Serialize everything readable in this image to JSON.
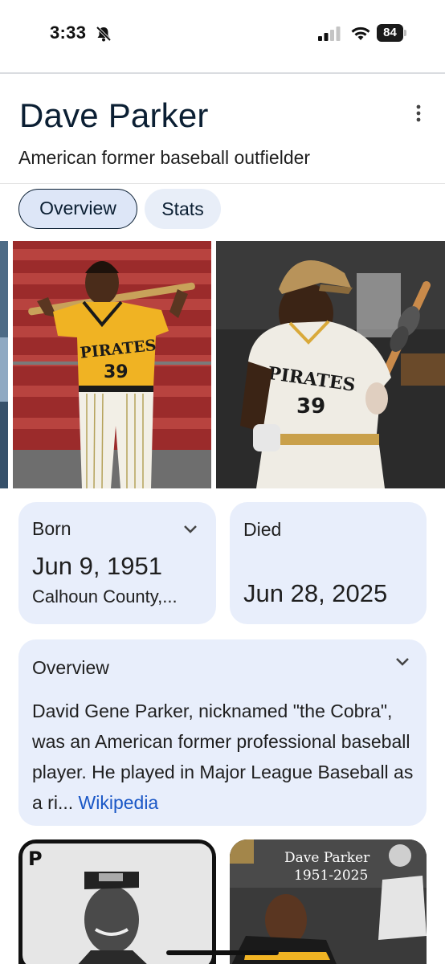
{
  "status_bar": {
    "time": "3:33",
    "battery": "84",
    "icons": [
      "bell-slash-icon",
      "signal-icon",
      "wifi-icon",
      "battery-icon"
    ]
  },
  "header": {
    "title": "Dave Parker",
    "subtitle": "American former baseball outfielder",
    "more_icon": "more-vert-icon"
  },
  "tabs": [
    {
      "label": "Overview",
      "selected": true
    },
    {
      "label": "Stats",
      "selected": false
    }
  ],
  "images": {
    "photo1": {
      "jersey_text": "PIRATES",
      "number": "39"
    },
    "photo2": {
      "jersey_text": "PIRATES",
      "number": "39"
    }
  },
  "born": {
    "label": "Born",
    "date": "Jun 9, 1951",
    "place": "Calhoun County,..."
  },
  "died": {
    "label": "Died",
    "date": "Jun 28, 2025"
  },
  "overview": {
    "label": "Overview",
    "text": "David Gene Parker, nicknamed \"the Cobra\", was an American former professional baseball player. He played in Major League Baseball as a ri...",
    "link": "Wikipedia"
  },
  "thumbnails": {
    "thumb1": {
      "logo_letter": "P"
    },
    "thumb2": {
      "name": "Dave Parker",
      "years": "1951-2025"
    }
  },
  "colors": {
    "card_bg": "#e8eefb",
    "chip_selected_bg": "#dde6f7",
    "link": "#1a57c6",
    "pirates_gold": "#f0b323",
    "title_color": "#0b1f33"
  }
}
